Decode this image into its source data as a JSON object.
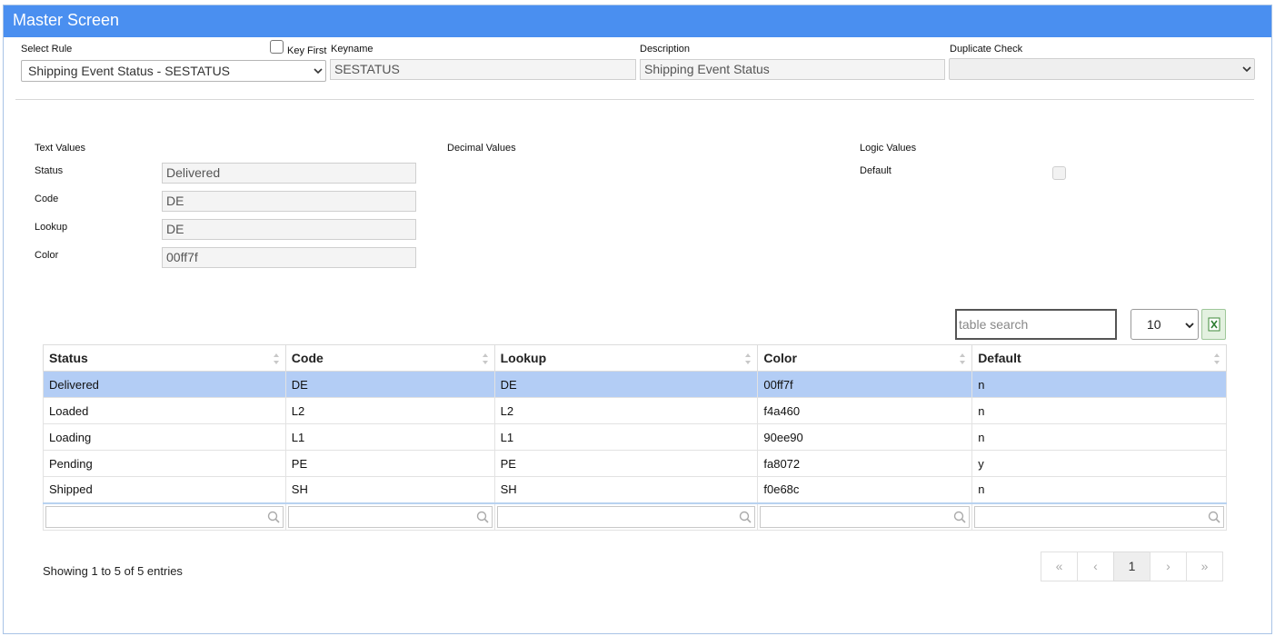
{
  "window": {
    "title": "Master Screen"
  },
  "header": {
    "select_rule_label": "Select Rule",
    "select_rule_value": "Shipping Event Status - SESTATUS",
    "key_first_label": "Key First",
    "keyname_label": "Keyname",
    "keyname_value": "SESTATUS",
    "description_label": "Description",
    "description_value": "Shipping Event Status",
    "duplicate_check_label": "Duplicate Check",
    "duplicate_check_value": ""
  },
  "form": {
    "text_values_heading": "Text Values",
    "decimal_values_heading": "Decimal Values",
    "logic_values_heading": "Logic Values",
    "status_label": "Status",
    "status_value": "Delivered",
    "code_label": "Code",
    "code_value": "DE",
    "lookup_label": "Lookup",
    "lookup_value": "DE",
    "color_label": "Color",
    "color_value": "00ff7f",
    "default_label": "Default"
  },
  "table_tools": {
    "search_placeholder": "table search",
    "page_size": "10"
  },
  "table": {
    "columns": [
      "Status",
      "Code",
      "Lookup",
      "Color",
      "Default"
    ],
    "rows": [
      [
        "Delivered",
        "DE",
        "DE",
        "00ff7f",
        "n"
      ],
      [
        "Loaded",
        "L2",
        "L2",
        "f4a460",
        "n"
      ],
      [
        "Loading",
        "L1",
        "L1",
        "90ee90",
        "n"
      ],
      [
        "Pending",
        "PE",
        "PE",
        "fa8072",
        "y"
      ],
      [
        "Shipped",
        "SH",
        "SH",
        "f0e68c",
        "n"
      ]
    ]
  },
  "footer": {
    "info": "Showing 1 to 5 of 5 entries",
    "pager": {
      "first": "«",
      "prev": "‹",
      "page": "1",
      "next": "›",
      "last": "»"
    }
  },
  "colors": {
    "titlebar": "#4a8ff0",
    "selected_row": "#b3cdf5"
  },
  "icons": [
    "chevron-down-icon",
    "excel-icon",
    "search-icon",
    "sort-icon"
  ]
}
